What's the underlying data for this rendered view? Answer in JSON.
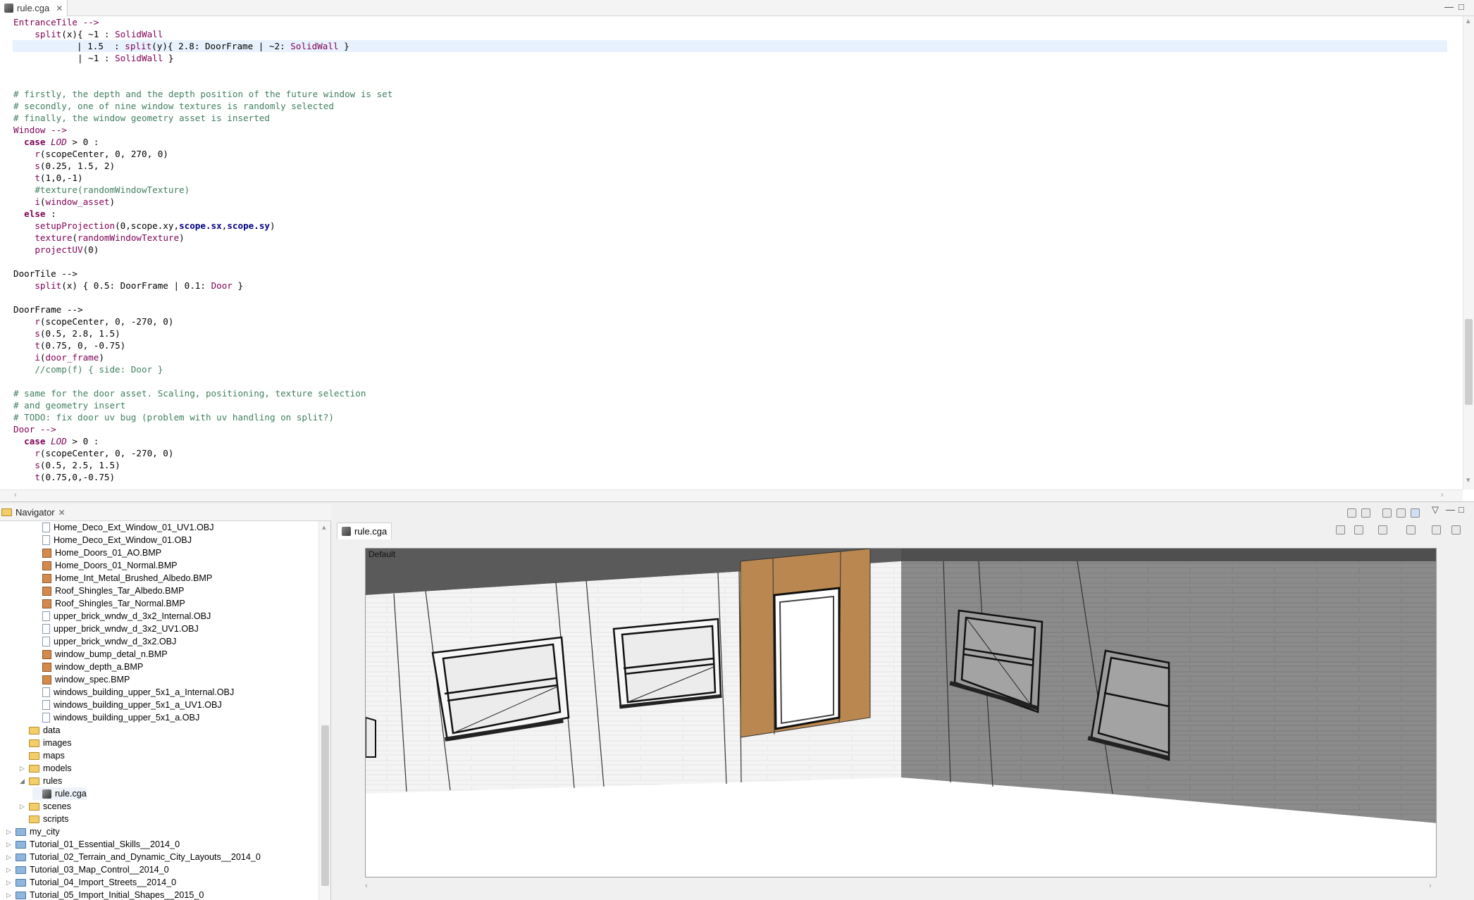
{
  "editor": {
    "tab_label": "rule.cga",
    "tab_close": "✕",
    "lines": [
      [
        [
          "EntranceTile -->",
          "t-k"
        ]
      ],
      [
        [
          "    split",
          "t-k"
        ],
        [
          "(x){ ~1 : ",
          ""
        ],
        [
          "SolidWall",
          "t-k"
        ]
      ],
      [
        [
          "            | 1.5  : ",
          ""
        ],
        [
          "split",
          "t-k"
        ],
        [
          "(y){ 2.8: DoorFrame | ~2: ",
          ""
        ],
        [
          "SolidWall",
          "t-k"
        ],
        [
          " }",
          ""
        ]
      ],
      [
        [
          "            | ~1 : ",
          ""
        ],
        [
          "SolidWall",
          "t-k"
        ],
        [
          " }",
          ""
        ]
      ],
      [
        [
          "",
          ""
        ]
      ],
      [
        [
          "",
          ""
        ]
      ],
      [
        [
          "# firstly, the depth and the depth position of the future window is set",
          "t-c"
        ]
      ],
      [
        [
          "# secondly, one of nine window textures is randomly selected",
          "t-c"
        ]
      ],
      [
        [
          "# finally, the window geometry asset is inserted",
          "t-c"
        ]
      ],
      [
        [
          "Window -->",
          "t-k"
        ]
      ],
      [
        [
          "  case ",
          "t-kw"
        ],
        [
          "LOD",
          "t-f"
        ],
        [
          " > 0 :",
          ""
        ]
      ],
      [
        [
          "    r",
          "t-k"
        ],
        [
          "(scopeCenter, 0, 270, 0)",
          ""
        ]
      ],
      [
        [
          "    s",
          "t-k"
        ],
        [
          "(0.25, 1.5, 2)",
          ""
        ]
      ],
      [
        [
          "    t",
          "t-k"
        ],
        [
          "(1,0,-1)",
          ""
        ]
      ],
      [
        [
          "    #texture(randomWindowTexture)",
          "t-c"
        ]
      ],
      [
        [
          "    i",
          "t-k"
        ],
        [
          "(",
          ""
        ],
        [
          "window_asset",
          "t-k"
        ],
        [
          ")",
          ""
        ]
      ],
      [
        [
          "  else ",
          "t-kw"
        ],
        [
          ":",
          ""
        ]
      ],
      [
        [
          "    setupProjection",
          "t-k"
        ],
        [
          "(0,scope.xy,",
          ""
        ],
        [
          "scope.sx",
          "t-b"
        ],
        [
          ",",
          ""
        ],
        [
          "scope.sy",
          "t-b"
        ],
        [
          ")",
          ""
        ]
      ],
      [
        [
          "    texture",
          "t-k"
        ],
        [
          "(",
          ""
        ],
        [
          "randomWindowTexture",
          "t-k"
        ],
        [
          ")",
          ""
        ]
      ],
      [
        [
          "    projectUV",
          "t-k"
        ],
        [
          "(0)",
          ""
        ]
      ],
      [
        [
          "",
          ""
        ]
      ],
      [
        [
          "DoorTile -->",
          ""
        ]
      ],
      [
        [
          "    split",
          "t-k"
        ],
        [
          "(x) { 0.5: DoorFrame | 0.1: ",
          ""
        ],
        [
          "Door",
          "t-k"
        ],
        [
          " }",
          ""
        ]
      ],
      [
        [
          "",
          ""
        ]
      ],
      [
        [
          "DoorFrame -->",
          ""
        ]
      ],
      [
        [
          "    r",
          "t-k"
        ],
        [
          "(scopeCenter, 0, -270, 0)",
          ""
        ]
      ],
      [
        [
          "    s",
          "t-k"
        ],
        [
          "(0.5, 2.8, 1.5)",
          ""
        ]
      ],
      [
        [
          "    t",
          "t-k"
        ],
        [
          "(0.75, 0, -0.75)",
          ""
        ]
      ],
      [
        [
          "    i",
          "t-k"
        ],
        [
          "(",
          ""
        ],
        [
          "door_frame",
          "t-k"
        ],
        [
          ")",
          ""
        ]
      ],
      [
        [
          "    //comp(f) { side: Door }",
          "t-c"
        ]
      ],
      [
        [
          "",
          ""
        ]
      ],
      [
        [
          "# same for the door asset. Scaling, positioning, texture selection",
          "t-c"
        ]
      ],
      [
        [
          "# and geometry insert",
          "t-c"
        ]
      ],
      [
        [
          "# TODO: fix door uv bug (problem with uv handling on split?)",
          "t-c"
        ]
      ],
      [
        [
          "Door -->",
          "t-k"
        ]
      ],
      [
        [
          "  case ",
          "t-kw"
        ],
        [
          "LOD",
          "t-f"
        ],
        [
          " > 0 :",
          ""
        ]
      ],
      [
        [
          "    r",
          "t-k"
        ],
        [
          "(scopeCenter, 0, -270, 0)",
          ""
        ]
      ],
      [
        [
          "    s",
          "t-k"
        ],
        [
          "(0.5, 2.5, 1.5)",
          ""
        ]
      ],
      [
        [
          "    t",
          "t-k"
        ],
        [
          "(0.75,0,-0.75)",
          ""
        ]
      ]
    ]
  },
  "navigator": {
    "title": "Navigator",
    "close": "✕",
    "items": [
      {
        "label": "Home_Deco_Ext_Window_01_UV1.OBJ",
        "icon": "file",
        "indent": 2
      },
      {
        "label": "Home_Deco_Ext_Window_01.OBJ",
        "icon": "file",
        "indent": 2
      },
      {
        "label": "Home_Doors_01_AO.BMP",
        "icon": "image",
        "indent": 2
      },
      {
        "label": "Home_Doors_01_Normal.BMP",
        "icon": "image",
        "indent": 2
      },
      {
        "label": "Home_Int_Metal_Brushed_Albedo.BMP",
        "icon": "image",
        "indent": 2
      },
      {
        "label": "Roof_Shingles_Tar_Albedo.BMP",
        "icon": "image",
        "indent": 2
      },
      {
        "label": "Roof_Shingles_Tar_Normal.BMP",
        "icon": "image",
        "indent": 2
      },
      {
        "label": "upper_brick_wndw_d_3x2_Internal.OBJ",
        "icon": "file",
        "indent": 2
      },
      {
        "label": "upper_brick_wndw_d_3x2_UV1.OBJ",
        "icon": "file",
        "indent": 2
      },
      {
        "label": "upper_brick_wndw_d_3x2.OBJ",
        "icon": "file",
        "indent": 2
      },
      {
        "label": "window_bump_detal_n.BMP",
        "icon": "image",
        "indent": 2
      },
      {
        "label": "window_depth_a.BMP",
        "icon": "image",
        "indent": 2
      },
      {
        "label": "window_spec.BMP",
        "icon": "image",
        "indent": 2
      },
      {
        "label": "windows_building_upper_5x1_a_Internal.OBJ",
        "icon": "file",
        "indent": 2
      },
      {
        "label": "windows_building_upper_5x1_a_UV1.OBJ",
        "icon": "file",
        "indent": 2
      },
      {
        "label": "windows_building_upper_5x1_a.OBJ",
        "icon": "file",
        "indent": 2
      },
      {
        "label": "data",
        "icon": "folder",
        "indent": 1,
        "twisty": ""
      },
      {
        "label": "images",
        "icon": "folder",
        "indent": 1,
        "twisty": ""
      },
      {
        "label": "maps",
        "icon": "folder",
        "indent": 1,
        "twisty": ""
      },
      {
        "label": "models",
        "icon": "folder",
        "indent": 1,
        "twisty": "▷"
      },
      {
        "label": "rules",
        "icon": "folder",
        "indent": 1,
        "twisty": "◢"
      },
      {
        "label": "rule.cga",
        "icon": "rule",
        "indent": 2
      },
      {
        "label": "scenes",
        "icon": "folder",
        "indent": 1,
        "twisty": "▷"
      },
      {
        "label": "scripts",
        "icon": "folder",
        "indent": 1,
        "twisty": ""
      },
      {
        "label": "my_city",
        "icon": "project",
        "indent": 0,
        "twisty": "▷"
      },
      {
        "label": "Tutorial_01_Essential_Skills__2014_0",
        "icon": "project",
        "indent": 0,
        "twisty": "▷"
      },
      {
        "label": "Tutorial_02_Terrain_and_Dynamic_City_Layouts__2014_0",
        "icon": "project",
        "indent": 0,
        "twisty": "▷"
      },
      {
        "label": "Tutorial_03_Map_Control__2014_0",
        "icon": "project",
        "indent": 0,
        "twisty": "▷"
      },
      {
        "label": "Tutorial_04_Import_Streets__2014_0",
        "icon": "project",
        "indent": 0,
        "twisty": "▷"
      },
      {
        "label": "Tutorial_05_Import_Initial_Shapes__2015_0",
        "icon": "project",
        "indent": 0,
        "twisty": "▷"
      }
    ]
  },
  "viewport": {
    "tab_label": "rule.cga",
    "scene_label": "Default"
  },
  "colors": {
    "door_frame": "#b9874f",
    "wall_white": "#f2f2f2",
    "wall_gray": "#8e8e8e",
    "ceiling": "#555555"
  }
}
